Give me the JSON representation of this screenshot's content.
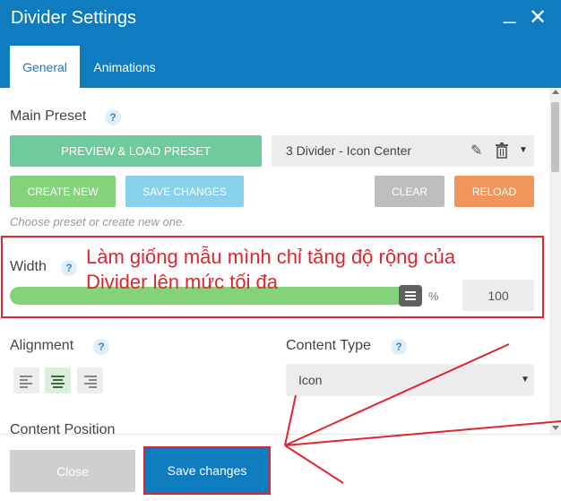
{
  "dialog": {
    "title": "Divider Settings",
    "minimize_glyph": "_",
    "close_glyph": "✕"
  },
  "tabs": [
    {
      "label": "General",
      "active": true
    },
    {
      "label": "Animations",
      "active": false
    }
  ],
  "main_preset": {
    "label": "Main Preset",
    "help": "?",
    "preview_button": "PREVIEW & LOAD PRESET",
    "selected_preset": "3 Divider - Icon Center",
    "create_new": "CREATE NEW",
    "save_changes": "SAVE CHANGES",
    "clear": "CLEAR",
    "reload": "RELOAD",
    "hint": "Choose preset or create new one."
  },
  "width": {
    "label": "Width",
    "help": "?",
    "value": "100",
    "unit": "%",
    "slider_fraction": 1.0
  },
  "annotation": {
    "text": "Làm giống mẫu mình chỉ tăng độ rộng của Divider lên mức tối đa",
    "color": "#e0252e"
  },
  "alignment": {
    "label": "Alignment",
    "help": "?",
    "options": [
      "left",
      "center",
      "right"
    ],
    "selected": "center"
  },
  "content_type": {
    "label": "Content Type",
    "help": "?",
    "value": "Icon"
  },
  "content_position": {
    "label": "Content Position"
  },
  "footer": {
    "close": "Close",
    "save": "Save changes"
  },
  "colors": {
    "header": "#0f7cbf",
    "green": "#84d27a",
    "teal": "#6ecb9b",
    "light_blue": "#87d1ea",
    "orange": "#f0965c",
    "grey": "#bdbdbd",
    "annotation_red": "#e0252e"
  }
}
